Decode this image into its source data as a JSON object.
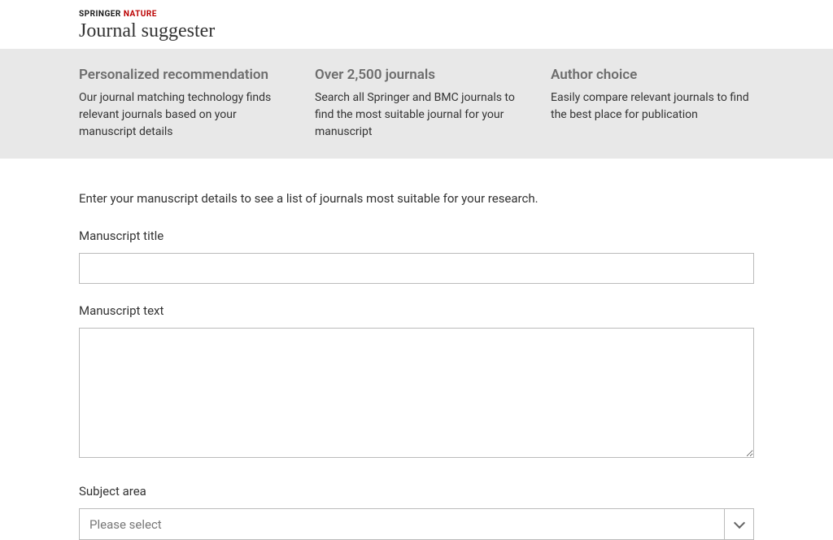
{
  "brand": {
    "springer": "SPRINGER",
    "nature": "NATURE"
  },
  "page_title": "Journal suggester",
  "features": [
    {
      "title": "Personalized recommendation",
      "desc": "Our journal matching technology finds relevant journals based on your manuscript details"
    },
    {
      "title": "Over 2,500 journals",
      "desc": "Search all Springer and BMC journals to find the most suitable journal for your manuscript"
    },
    {
      "title": "Author choice",
      "desc": "Easily compare relevant journals to find the best place for publication"
    }
  ],
  "intro_text": "Enter your manuscript details to see a list of journals most suitable for your research.",
  "form": {
    "title_label": "Manuscript title",
    "title_value": "",
    "text_label": "Manuscript text",
    "text_value": "",
    "subject_label": "Subject area",
    "subject_placeholder": "Please select"
  }
}
